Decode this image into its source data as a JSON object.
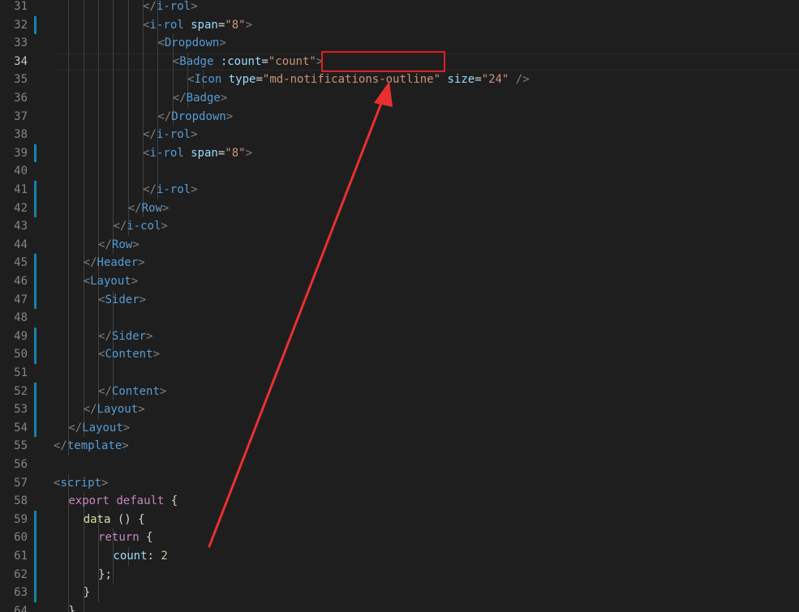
{
  "editor": {
    "active_line": 34,
    "lines": [
      {
        "n": 31,
        "indent": 8,
        "mod": false,
        "tokens": [
          [
            "p",
            "</"
          ],
          [
            "t",
            "i-rol"
          ],
          [
            "p",
            ">"
          ]
        ]
      },
      {
        "n": 32,
        "indent": 8,
        "mod": true,
        "tokens": [
          [
            "p",
            "<"
          ],
          [
            "t",
            "i-rol"
          ],
          [
            "tx",
            " "
          ],
          [
            "a",
            "span"
          ],
          [
            "tx",
            "="
          ],
          [
            "s",
            "\"8\""
          ],
          [
            "p",
            ">"
          ]
        ]
      },
      {
        "n": 33,
        "indent": 9,
        "mod": false,
        "tokens": [
          [
            "p",
            "<"
          ],
          [
            "t",
            "Dropdown"
          ],
          [
            "p",
            ">"
          ]
        ]
      },
      {
        "n": 34,
        "indent": 10,
        "mod": false,
        "tokens": [
          [
            "p",
            "<"
          ],
          [
            "t",
            "Badge"
          ],
          [
            "tx",
            " "
          ],
          [
            "a",
            ":count"
          ],
          [
            "tx",
            "="
          ],
          [
            "s",
            "\"count\""
          ],
          [
            "p",
            ">"
          ]
        ]
      },
      {
        "n": 35,
        "indent": 11,
        "mod": false,
        "tokens": [
          [
            "p",
            "<"
          ],
          [
            "t",
            "Icon"
          ],
          [
            "tx",
            " "
          ],
          [
            "a",
            "type"
          ],
          [
            "tx",
            "="
          ],
          [
            "s",
            "\"md-notifications-outline\""
          ],
          [
            "tx",
            " "
          ],
          [
            "a",
            "size"
          ],
          [
            "tx",
            "="
          ],
          [
            "s",
            "\"24\""
          ],
          [
            "tx",
            " "
          ],
          [
            "p",
            "/>"
          ]
        ]
      },
      {
        "n": 36,
        "indent": 10,
        "mod": false,
        "tokens": [
          [
            "p",
            "</"
          ],
          [
            "t",
            "Badge"
          ],
          [
            "p",
            ">"
          ]
        ]
      },
      {
        "n": 37,
        "indent": 9,
        "mod": false,
        "tokens": [
          [
            "p",
            "</"
          ],
          [
            "t",
            "Dropdown"
          ],
          [
            "p",
            ">"
          ]
        ]
      },
      {
        "n": 38,
        "indent": 8,
        "mod": false,
        "tokens": [
          [
            "p",
            "</"
          ],
          [
            "t",
            "i-rol"
          ],
          [
            "p",
            ">"
          ]
        ]
      },
      {
        "n": 39,
        "indent": 8,
        "mod": true,
        "tokens": [
          [
            "p",
            "<"
          ],
          [
            "t",
            "i-rol"
          ],
          [
            "tx",
            " "
          ],
          [
            "a",
            "span"
          ],
          [
            "tx",
            "="
          ],
          [
            "s",
            "\"8\""
          ],
          [
            "p",
            ">"
          ]
        ]
      },
      {
        "n": 40,
        "indent": 8,
        "mod": false,
        "tokens": []
      },
      {
        "n": 41,
        "indent": 8,
        "mod": true,
        "tokens": [
          [
            "p",
            "</"
          ],
          [
            "t",
            "i-rol"
          ],
          [
            "p",
            ">"
          ]
        ]
      },
      {
        "n": 42,
        "indent": 7,
        "mod": true,
        "tokens": [
          [
            "p",
            "</"
          ],
          [
            "t",
            "Row"
          ],
          [
            "p",
            ">"
          ]
        ]
      },
      {
        "n": 43,
        "indent": 6,
        "mod": false,
        "tokens": [
          [
            "p",
            "</"
          ],
          [
            "t",
            "i-col"
          ],
          [
            "p",
            ">"
          ]
        ]
      },
      {
        "n": 44,
        "indent": 5,
        "mod": false,
        "tokens": [
          [
            "p",
            "</"
          ],
          [
            "t",
            "Row"
          ],
          [
            "p",
            ">"
          ]
        ]
      },
      {
        "n": 45,
        "indent": 4,
        "mod": true,
        "tokens": [
          [
            "p",
            "</"
          ],
          [
            "t",
            "Header"
          ],
          [
            "p",
            ">"
          ]
        ]
      },
      {
        "n": 46,
        "indent": 4,
        "mod": true,
        "tokens": [
          [
            "p",
            "<"
          ],
          [
            "t",
            "Layout"
          ],
          [
            "p",
            ">"
          ]
        ]
      },
      {
        "n": 47,
        "indent": 5,
        "mod": true,
        "tokens": [
          [
            "p",
            "<"
          ],
          [
            "t",
            "Sider"
          ],
          [
            "p",
            ">"
          ]
        ]
      },
      {
        "n": 48,
        "indent": 5,
        "mod": false,
        "tokens": []
      },
      {
        "n": 49,
        "indent": 5,
        "mod": true,
        "tokens": [
          [
            "p",
            "</"
          ],
          [
            "t",
            "Sider"
          ],
          [
            "p",
            ">"
          ]
        ]
      },
      {
        "n": 50,
        "indent": 5,
        "mod": true,
        "tokens": [
          [
            "p",
            "<"
          ],
          [
            "t",
            "Content"
          ],
          [
            "p",
            ">"
          ]
        ]
      },
      {
        "n": 51,
        "indent": 5,
        "mod": false,
        "tokens": []
      },
      {
        "n": 52,
        "indent": 5,
        "mod": true,
        "tokens": [
          [
            "p",
            "</"
          ],
          [
            "t",
            "Content"
          ],
          [
            "p",
            ">"
          ]
        ]
      },
      {
        "n": 53,
        "indent": 4,
        "mod": true,
        "tokens": [
          [
            "p",
            "</"
          ],
          [
            "t",
            "Layout"
          ],
          [
            "p",
            ">"
          ]
        ]
      },
      {
        "n": 54,
        "indent": 3,
        "mod": true,
        "tokens": [
          [
            "p",
            "</"
          ],
          [
            "t",
            "Layout"
          ],
          [
            "p",
            ">"
          ]
        ]
      },
      {
        "n": 55,
        "indent": 2,
        "mod": false,
        "tokens": [
          [
            "p",
            "</"
          ],
          [
            "t",
            "template"
          ],
          [
            "p",
            ">"
          ]
        ]
      },
      {
        "n": 56,
        "indent": 0,
        "mod": false,
        "tokens": []
      },
      {
        "n": 57,
        "indent": 2,
        "mod": false,
        "tokens": [
          [
            "p",
            "<"
          ],
          [
            "t",
            "script"
          ],
          [
            "p",
            ">"
          ]
        ]
      },
      {
        "n": 58,
        "indent": 3,
        "mod": false,
        "tokens": [
          [
            "k",
            "export"
          ],
          [
            "tx",
            " "
          ],
          [
            "k",
            "default"
          ],
          [
            "tx",
            " {"
          ]
        ]
      },
      {
        "n": 59,
        "indent": 4,
        "mod": true,
        "tokens": [
          [
            "f",
            "data"
          ],
          [
            "tx",
            " () {"
          ]
        ]
      },
      {
        "n": 60,
        "indent": 5,
        "mod": true,
        "tokens": [
          [
            "k",
            "return"
          ],
          [
            "tx",
            " {"
          ]
        ]
      },
      {
        "n": 61,
        "indent": 6,
        "mod": true,
        "tokens": [
          [
            "a",
            "count"
          ],
          [
            "tx",
            ": "
          ],
          [
            "n",
            "2"
          ]
        ]
      },
      {
        "n": 62,
        "indent": 5,
        "mod": true,
        "tokens": [
          [
            "tx",
            "};"
          ]
        ]
      },
      {
        "n": 63,
        "indent": 4,
        "mod": true,
        "tokens": [
          [
            "tx",
            "}"
          ]
        ]
      },
      {
        "n": 64,
        "indent": 3,
        "mod": false,
        "tokens": [
          [
            "tx",
            "},"
          ]
        ]
      }
    ]
  },
  "colors": {
    "background": "#1e1e1e",
    "tag": "#569cd6",
    "attribute": "#9cdcfe",
    "string": "#ce9178",
    "keyword": "#c586c0",
    "function": "#dcdcaa",
    "number": "#b5cea8",
    "modified_bar": "#1b81a8",
    "annotation": "#e02020"
  }
}
